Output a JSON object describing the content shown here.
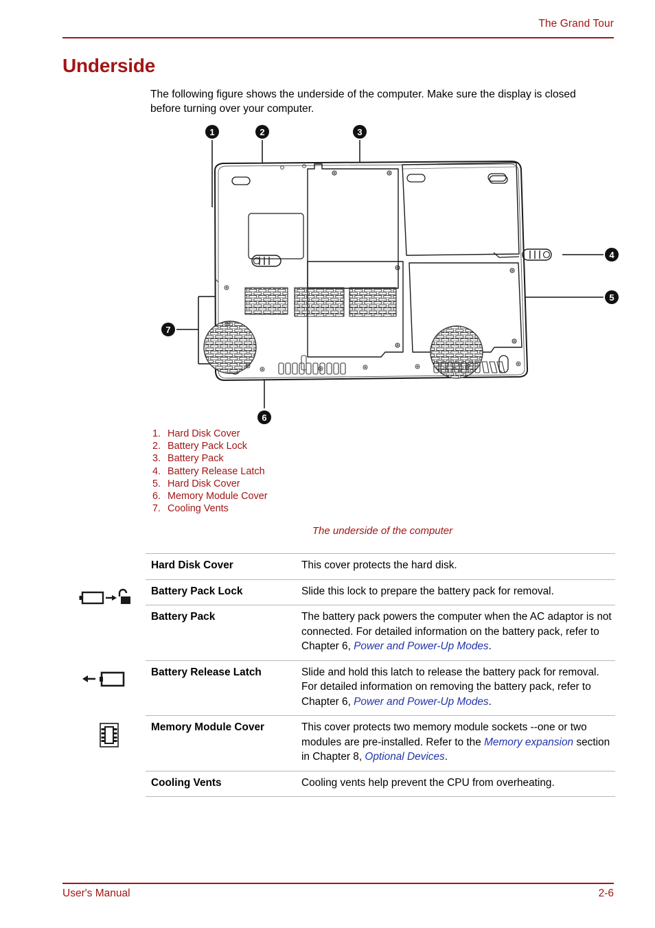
{
  "header": {
    "chapter_title": "The Grand Tour"
  },
  "section": {
    "heading": "Underside",
    "intro": "The following figure shows the underside of the computer. Make sure the display is closed before turning over your computer."
  },
  "figure": {
    "caption": "The underside of the computer",
    "callouts": [
      {
        "num": "1"
      },
      {
        "num": "2"
      },
      {
        "num": "3"
      },
      {
        "num": "4"
      },
      {
        "num": "5"
      },
      {
        "num": "6"
      },
      {
        "num": "7"
      }
    ],
    "legend": [
      {
        "num": "1.",
        "label": "Hard Disk Cover"
      },
      {
        "num": "2.",
        "label": "Battery Pack Lock"
      },
      {
        "num": "3.",
        "label": "Battery Pack"
      },
      {
        "num": "4.",
        "label": "Battery Release Latch"
      },
      {
        "num": "5.",
        "label": "Hard Disk Cover"
      },
      {
        "num": "6.",
        "label": "Memory Module Cover"
      },
      {
        "num": "7.",
        "label": "Cooling Vents"
      }
    ]
  },
  "table": {
    "rows": [
      {
        "icon": "none",
        "term": "Hard Disk Cover",
        "desc_parts": [
          {
            "text": "This cover protects the hard disk.",
            "style": "plain"
          }
        ]
      },
      {
        "icon": "battery-unlock-icon",
        "term": "Battery Pack Lock",
        "desc_parts": [
          {
            "text": "Slide this lock to prepare the battery pack for removal.",
            "style": "plain"
          }
        ]
      },
      {
        "icon": "none",
        "term": "Battery Pack",
        "desc_parts": [
          {
            "text": "The battery pack powers the computer when the AC adaptor is not connected. For detailed information on the battery pack, refer to Chapter 6, ",
            "style": "plain"
          },
          {
            "text": "Power and Power-Up Modes",
            "style": "xref"
          },
          {
            "text": ".",
            "style": "plain"
          }
        ]
      },
      {
        "icon": "battery-release-icon",
        "term": "Battery Release Latch",
        "desc_parts": [
          {
            "text": "Slide and hold this latch to release the battery pack for removal. For detailed information on removing the battery pack, refer to Chapter 6, ",
            "style": "plain"
          },
          {
            "text": "Power and Power-Up Modes",
            "style": "xref"
          },
          {
            "text": ".",
            "style": "plain"
          }
        ]
      },
      {
        "icon": "memory-module-icon",
        "term": "Memory Module Cover",
        "desc_parts": [
          {
            "text": "This cover protects two memory module sockets --one or two modules are pre-installed. Refer to the ",
            "style": "plain"
          },
          {
            "text": "Memory expansion",
            "style": "xref"
          },
          {
            "text": " section in Chapter 8, ",
            "style": "plain"
          },
          {
            "text": "Optional Devices",
            "style": "xref"
          },
          {
            "text": ".",
            "style": "plain"
          }
        ]
      },
      {
        "icon": "none",
        "term": "Cooling Vents",
        "desc_parts": [
          {
            "text": "Cooling vents help prevent the CPU from overheating.",
            "style": "plain"
          }
        ]
      }
    ]
  },
  "footer": {
    "left": "User's Manual",
    "right": "2-6"
  },
  "colors": {
    "accent_red": "#A31515",
    "xref_blue": "#2233AA",
    "rule_gray": "#b8b8b8"
  }
}
